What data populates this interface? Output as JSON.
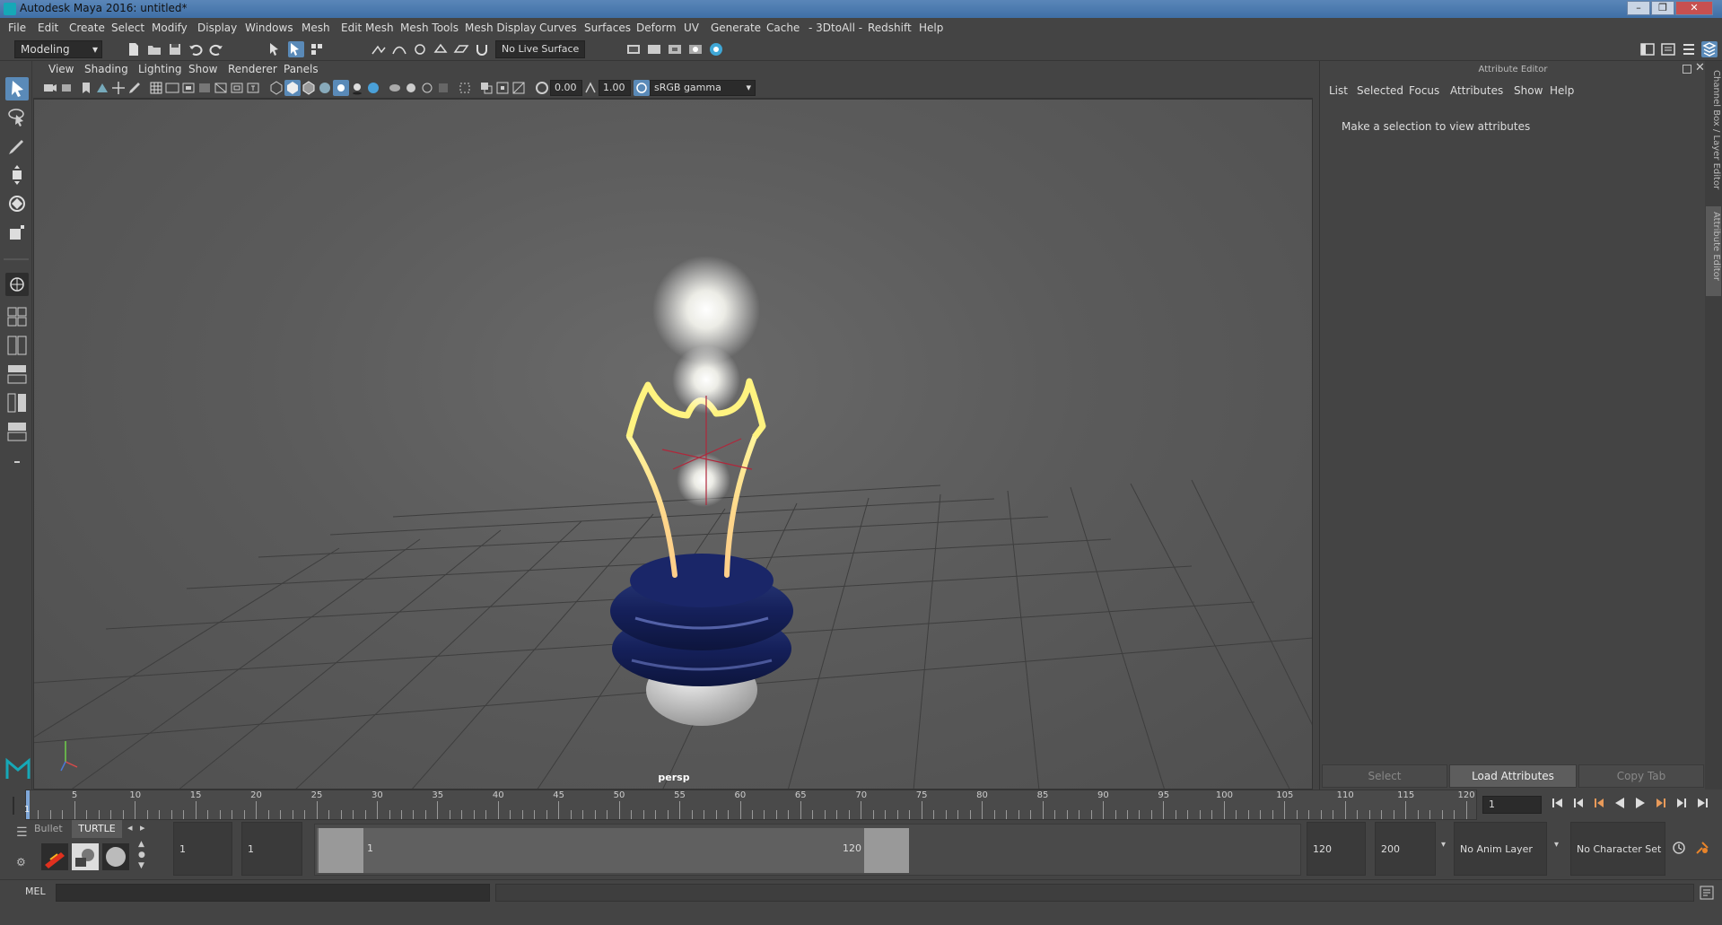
{
  "window": {
    "title": "Autodesk Maya 2016: untitled*",
    "controls": [
      "–",
      "❐",
      "✕"
    ]
  },
  "menubar": {
    "items": [
      "File",
      "Edit",
      "Create",
      "Select",
      "Modify",
      "Display",
      "Windows",
      "Mesh",
      "Edit Mesh",
      "Mesh Tools",
      "Mesh Display",
      "Curves",
      "Surfaces",
      "Deform",
      "UV",
      "Generate",
      "Cache",
      "- 3DtoAll -",
      "Redshift",
      "Help"
    ]
  },
  "statusline": {
    "menuset": "Modeling",
    "live_surface": "No Live Surface"
  },
  "panel": {
    "menus": [
      "View",
      "Shading",
      "Lighting",
      "Show",
      "Renderer",
      "Panels"
    ],
    "exposure": "0.00",
    "gamma": "1.00",
    "color_space": "sRGB gamma",
    "camera_label": "persp"
  },
  "attribute_editor": {
    "header": "Attribute Editor",
    "menus": [
      "List",
      "Selected",
      "Focus",
      "Attributes",
      "Show",
      "Help"
    ],
    "message": "Make a selection to view attributes",
    "buttons": [
      "Select",
      "Load Attributes",
      "Copy Tab"
    ],
    "side_tabs": [
      "Channel Box / Layer Editor",
      "Attribute Editor"
    ]
  },
  "timeline": {
    "current_frame": "1",
    "ticks": [
      "5",
      "10",
      "15",
      "20",
      "25",
      "30",
      "35",
      "40",
      "45",
      "50",
      "55",
      "60",
      "65",
      "70",
      "75",
      "80",
      "85",
      "90",
      "95",
      "100",
      "105",
      "110",
      "115",
      "120"
    ],
    "start_label": "1",
    "frame_field": "1"
  },
  "range": {
    "shelf_tabs": [
      "Bullet",
      "TURTLE"
    ],
    "start_time": "1",
    "playback_start": "1",
    "range_start_label": "1",
    "range_end_label": "120",
    "playback_end": "120",
    "end_time": "200",
    "anim_layer": "No Anim Layer",
    "character_set": "No Character Set"
  },
  "command_line": {
    "mode": "MEL"
  }
}
